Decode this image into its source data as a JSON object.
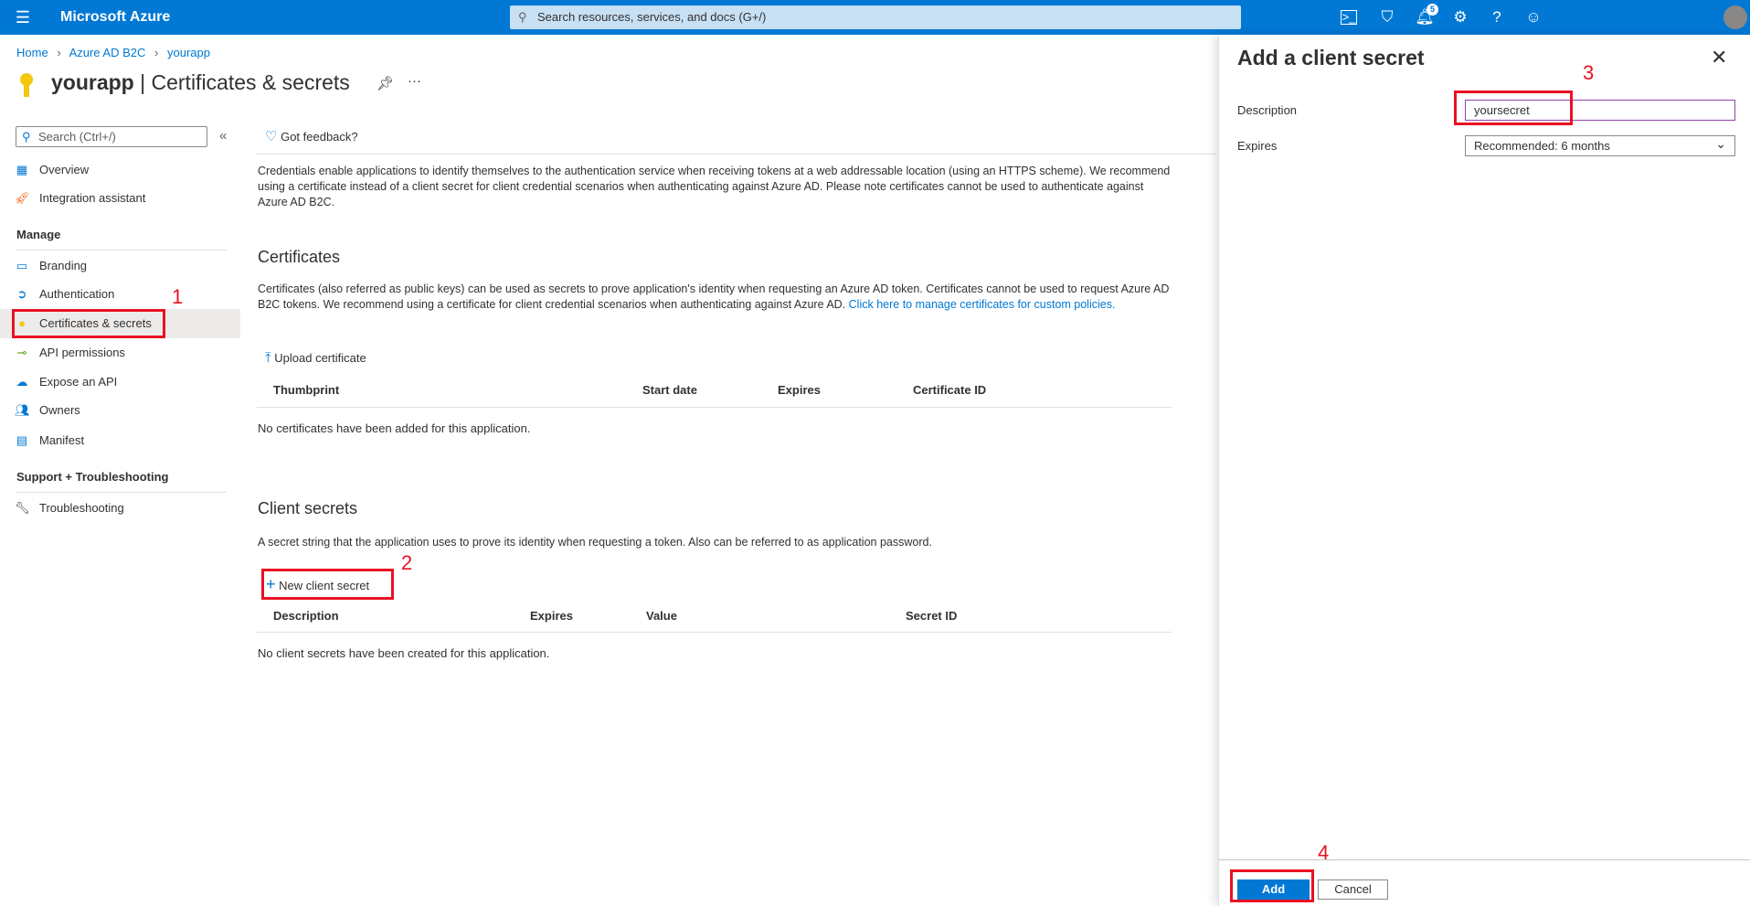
{
  "topbar": {
    "brand": "Microsoft Azure",
    "search_placeholder": "Search resources, services, and docs (G+/)",
    "notification_count": "5",
    "accent": "#0078d4",
    "icons": [
      "cloud-shell-icon",
      "directory-filter-icon",
      "notifications-icon",
      "settings-icon",
      "help-icon",
      "feedback-smiley-icon"
    ]
  },
  "breadcrumb": [
    "Home",
    "Azure AD B2C",
    "yourapp"
  ],
  "page": {
    "resource": "yourapp",
    "separator": "|",
    "title": "Certificates & secrets"
  },
  "sidebar": {
    "search_placeholder": "Search (Ctrl+/)",
    "items_top": [
      {
        "label": "Overview",
        "icon": "overview-grid-icon"
      },
      {
        "label": "Integration assistant",
        "icon": "rocket-icon"
      }
    ],
    "manage_heading": "Manage",
    "manage_items": [
      {
        "label": "Branding",
        "icon": "branding-icon"
      },
      {
        "label": "Authentication",
        "icon": "authentication-icon"
      },
      {
        "label": "Certificates & secrets",
        "icon": "key-icon",
        "selected": true
      },
      {
        "label": "API permissions",
        "icon": "api-permissions-icon"
      },
      {
        "label": "Expose an API",
        "icon": "cloud-icon"
      },
      {
        "label": "Owners",
        "icon": "owners-icon"
      },
      {
        "label": "Manifest",
        "icon": "manifest-icon"
      }
    ],
    "support_heading": "Support + Troubleshooting",
    "support_items": [
      {
        "label": "Troubleshooting",
        "icon": "wrench-icon"
      }
    ]
  },
  "main": {
    "feedback": "Got feedback?",
    "intro": "Credentials enable applications to identify themselves to the authentication service when receiving tokens at a web addressable location (using an HTTPS scheme). We recommend using a certificate instead of a client secret for client credential scenarios when authenticating against Azure AD. Please note certificates cannot be used to authenticate against Azure AD B2C.",
    "certificates": {
      "heading": "Certificates",
      "description": "Certificates (also referred as public keys) can be used as secrets to prove application's identity when requesting an Azure AD token. Certificates cannot be used to request Azure AD B2C tokens. We recommend using a certificate for client credential scenarios when authenticating against Azure AD.",
      "link": "Click here to manage certificates for custom policies.",
      "upload": "Upload certificate",
      "columns": [
        "Thumbprint",
        "Start date",
        "Expires",
        "Certificate ID"
      ],
      "empty": "No certificates have been added for this application."
    },
    "secrets": {
      "heading": "Client secrets",
      "description": "A secret string that the application uses to prove its identity when requesting a token. Also can be referred to as application password.",
      "new_button": "New client secret",
      "columns": [
        "Description",
        "Expires",
        "Value",
        "Secret ID"
      ],
      "empty": "No client secrets have been created for this application."
    }
  },
  "panel": {
    "title": "Add a client secret",
    "description_label": "Description",
    "description_value": "yoursecret",
    "expires_label": "Expires",
    "expires_value": "Recommended: 6 months",
    "add": "Add",
    "cancel": "Cancel"
  },
  "annotations": [
    "1",
    "2",
    "3",
    "4"
  ]
}
